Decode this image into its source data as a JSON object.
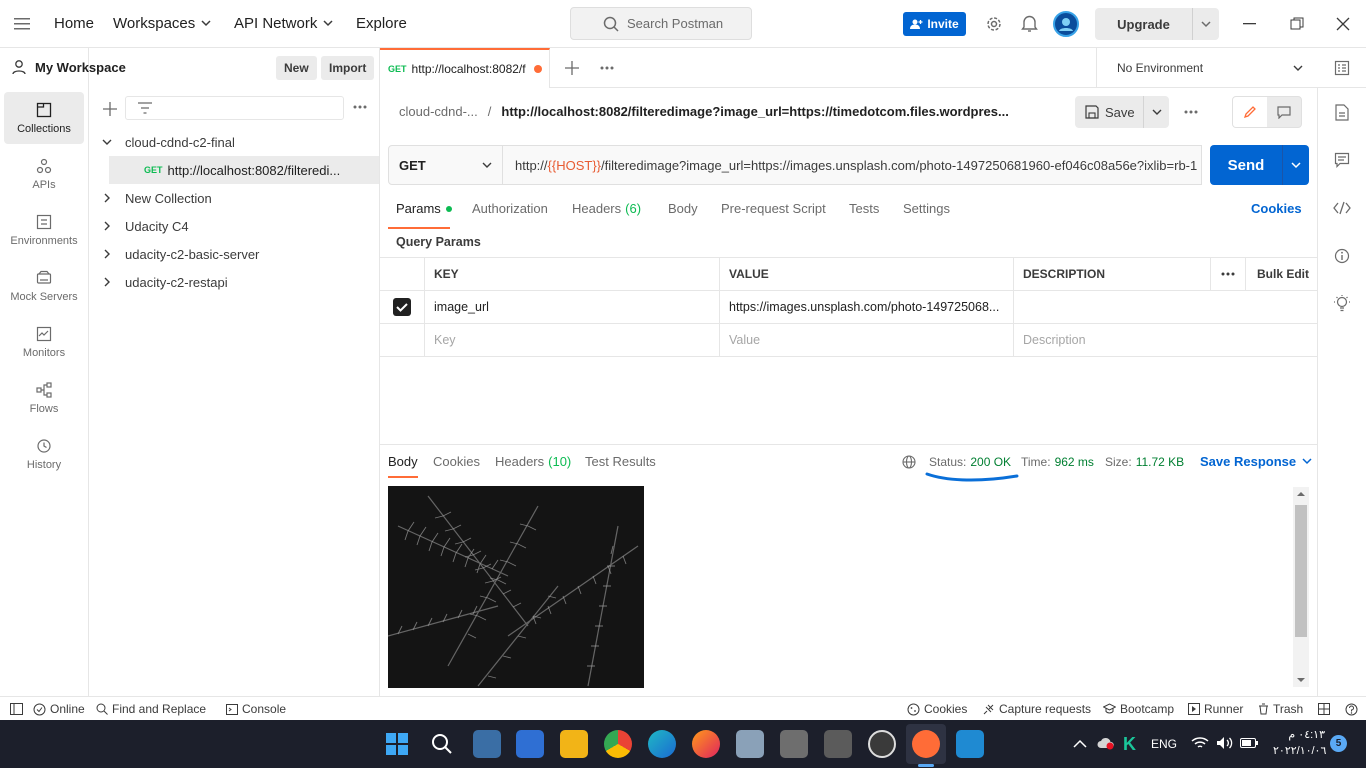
{
  "topbar": {
    "nav": [
      "Home",
      "Workspaces",
      "API Network",
      "Explore"
    ],
    "search_placeholder": "Search Postman",
    "invite_label": "Invite",
    "upgrade_label": "Upgrade"
  },
  "rail": {
    "items": [
      {
        "label": "Collections",
        "icon": "collections-icon"
      },
      {
        "label": "APIs",
        "icon": "apis-icon"
      },
      {
        "label": "Environments",
        "icon": "environments-icon"
      },
      {
        "label": "Mock Servers",
        "icon": "mock-servers-icon"
      },
      {
        "label": "Monitors",
        "icon": "monitors-icon"
      },
      {
        "label": "Flows",
        "icon": "flows-icon"
      },
      {
        "label": "History",
        "icon": "history-icon"
      }
    ]
  },
  "sidebar": {
    "workspace_name": "My Workspace",
    "new_label": "New",
    "import_label": "Import",
    "tree": [
      {
        "label": "cloud-cdnd-c2-final",
        "expanded": true
      },
      {
        "label": "http://localhost:8082/filteredi...",
        "method": "GET",
        "child": true
      },
      {
        "label": "New Collection"
      },
      {
        "label": "Udacity C4"
      },
      {
        "label": "udacity-c2-basic-server"
      },
      {
        "label": "udacity-c2-restapi"
      }
    ]
  },
  "tabs": {
    "active_method": "GET",
    "active_title": "http://localhost:8082/f",
    "environment": "No Environment"
  },
  "request": {
    "breadcrumb_collection": "cloud-cdnd-...",
    "breadcrumb_sep": "/",
    "breadcrumb_name": "http://localhost:8082/filteredimage?image_url=https://timedotcom.files.wordpres...",
    "save_label": "Save",
    "method": "GET",
    "url_prefix": "http://",
    "url_var": "{{HOST}}",
    "url_rest": "/filteredimage?image_url=https://images.unsplash.com/photo-1497250681960-ef046c08a56e?ixlib=rb-1",
    "send_label": "Send",
    "tabs": [
      {
        "label": "Params"
      },
      {
        "label": "Authorization"
      },
      {
        "label": "Headers",
        "count": "(6)"
      },
      {
        "label": "Body"
      },
      {
        "label": "Pre-request Script"
      },
      {
        "label": "Tests"
      },
      {
        "label": "Settings"
      }
    ],
    "cookies_label": "Cookies",
    "query_params_label": "Query Params",
    "table": {
      "headers": [
        "KEY",
        "VALUE",
        "DESCRIPTION"
      ],
      "bulk_edit": "Bulk Edit",
      "row_key": "image_url",
      "row_value": "https://images.unsplash.com/photo-149725068...",
      "placeholder_key": "Key",
      "placeholder_value": "Value",
      "placeholder_desc": "Description"
    }
  },
  "response": {
    "tabs": [
      {
        "label": "Body"
      },
      {
        "label": "Cookies"
      },
      {
        "label": "Headers",
        "count": "(10)"
      },
      {
        "label": "Test Results"
      }
    ],
    "status_label": "Status:",
    "status_value": "200 OK",
    "time_label": "Time:",
    "time_value": "962 ms",
    "size_label": "Size:",
    "size_value": "11.72 KB",
    "save_response": "Save Response"
  },
  "statusbar": {
    "online": "Online",
    "find_replace": "Find and Replace",
    "console": "Console",
    "cookies": "Cookies",
    "capture": "Capture requests",
    "bootcamp": "Bootcamp",
    "runner": "Runner",
    "trash": "Trash"
  },
  "taskbar": {
    "lang": "ENG",
    "time": "٠٤:١٣ م",
    "date": "٢٠٢٢/١٠/٠٦",
    "notification_count": "5"
  },
  "colors": {
    "accent": "#ff6c37",
    "primary": "#0265d2",
    "status_ok": "#007f31"
  }
}
